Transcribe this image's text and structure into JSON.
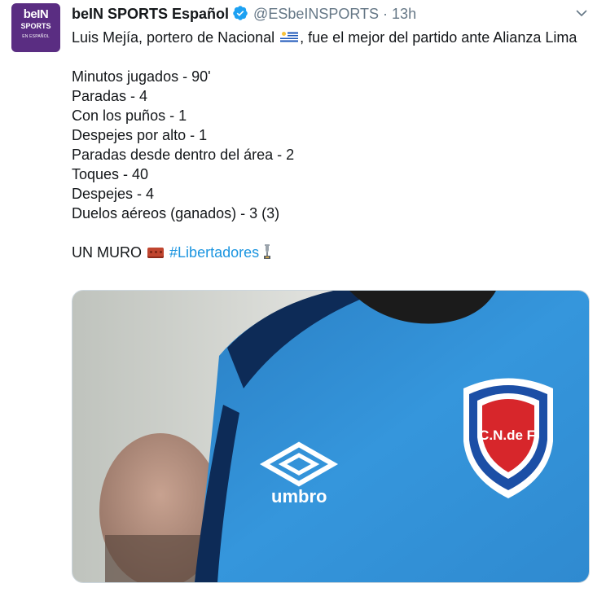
{
  "account": {
    "avatar_line1": "beIN",
    "avatar_line2": "SPORTS",
    "avatar_line3": "EN ESPAÑOL",
    "name": "beIN SPORTS Español",
    "handle": "@ESbeINSPORTS",
    "separator": "·",
    "time": "13h"
  },
  "tweet": {
    "lead_part1": "Luis Mejía, portero de Nacional",
    "lead_part2": ", fue el mejor del partido ante Alianza Lima",
    "stats": [
      "Minutos jugados - 90'",
      "Paradas - 4",
      "Con los puños - 1",
      "Despejes por alto - 1",
      "Paradas desde dentro del área - 2",
      "Toques - 40",
      "Despejes - 4",
      "Duelos aéreos (ganados) - 3 (3)"
    ],
    "closing_text": "UN MURO",
    "hashtag": "#Libertadores"
  },
  "media": {
    "jersey_brand": "umbro",
    "crest_text": "C.N.de F.",
    "colors": {
      "jersey": "#2f8fd6",
      "crest_red": "#d7262b",
      "crest_blue": "#1c4fa6"
    }
  },
  "icons": {
    "verified": "verified-badge-icon",
    "caret": "chevron-down-icon",
    "flag": "uruguay-flag-icon",
    "brick": "brick-icon",
    "trophy": "trophy-icon"
  },
  "colors": {
    "link": "#1b95e0",
    "muted": "#657786",
    "text": "#14171a",
    "avatar_bg": "#5a2d82"
  }
}
